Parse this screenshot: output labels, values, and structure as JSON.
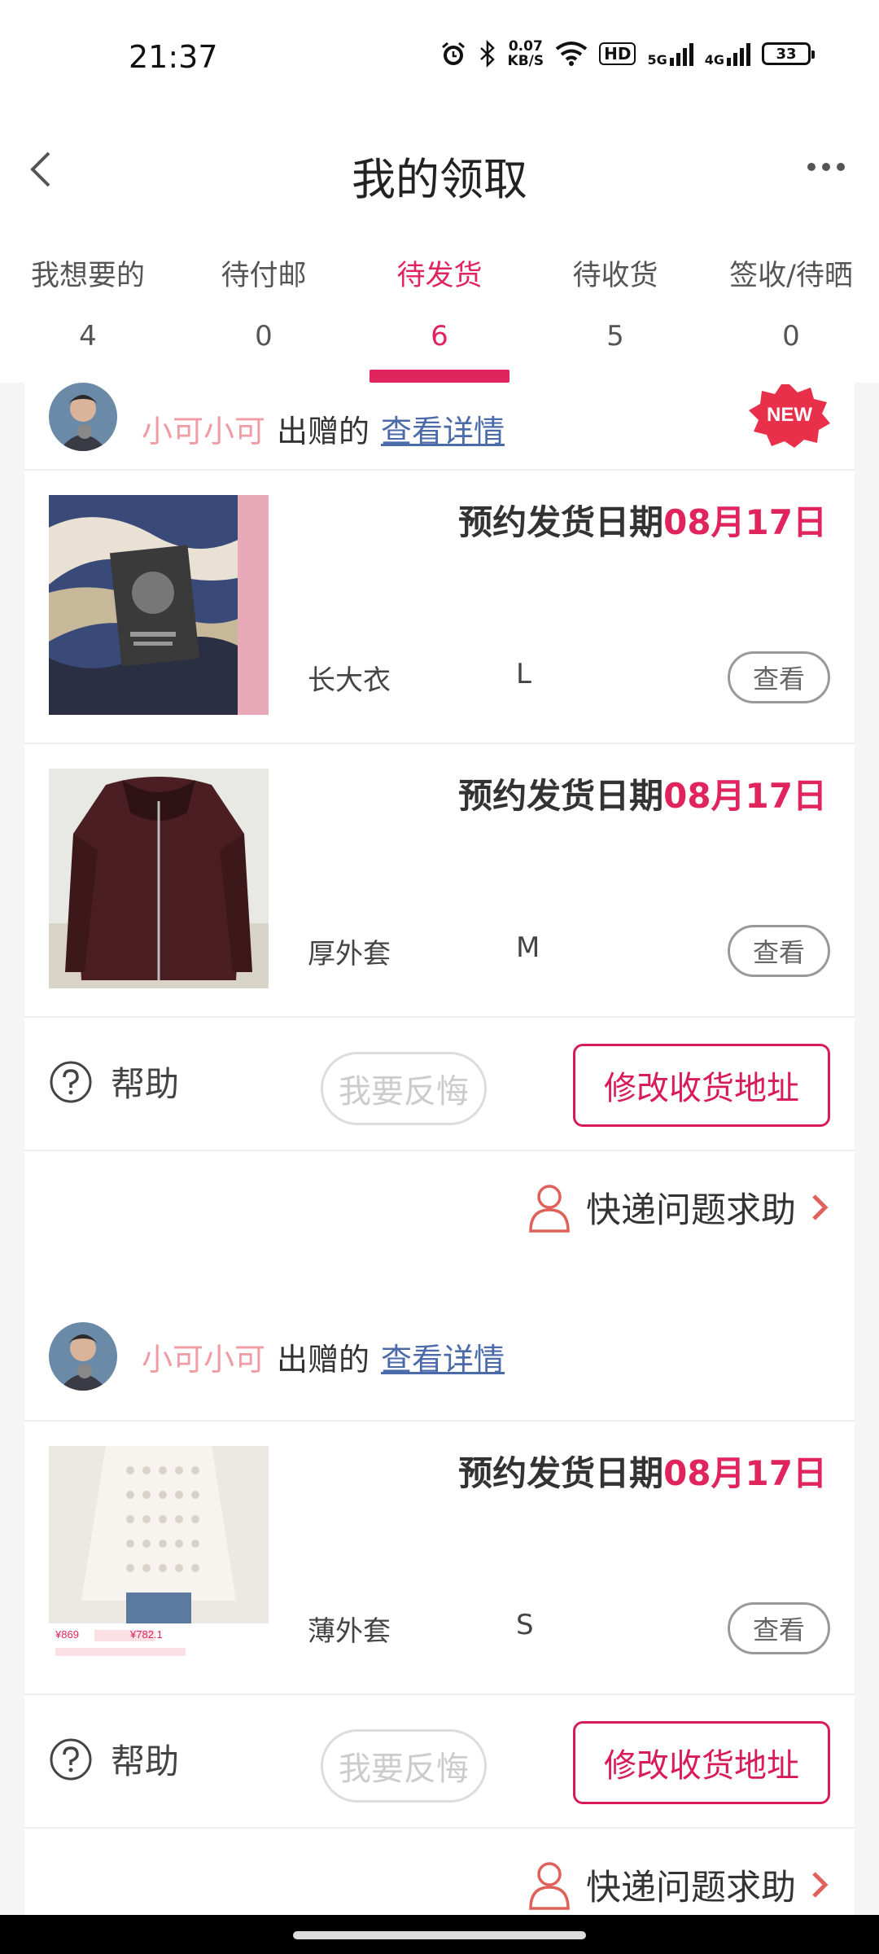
{
  "status_bar": {
    "time": "21:37",
    "net_speed_value": "0.07",
    "net_speed_unit": "KB/S",
    "hd_label": "HD",
    "net1_label": "5G",
    "net2_label": "4G",
    "battery": "33"
  },
  "nav": {
    "title": "我的领取"
  },
  "tabs": [
    {
      "label": "我想要的",
      "count": "4",
      "active": false
    },
    {
      "label": "待付邮",
      "count": "0",
      "active": false
    },
    {
      "label": "待发货",
      "count": "6",
      "active": true
    },
    {
      "label": "待收货",
      "count": "5",
      "active": false
    },
    {
      "label": "签收/待晒",
      "count": "0",
      "active": false
    }
  ],
  "cards": [
    {
      "giver": "小可小可",
      "giver_suffix": "出赠的",
      "detail_link": "查看详情",
      "new_badge": "NEW",
      "items": [
        {
          "ship_label": "预约发货日期",
          "ship_date": "08月17日",
          "name": "长大衣",
          "size": "L",
          "view_label": "查看"
        },
        {
          "ship_label": "预约发货日期",
          "ship_date": "08月17日",
          "name": "厚外套",
          "size": "M",
          "view_label": "查看"
        }
      ],
      "help_label": "帮助",
      "regret_label": "我要反悔",
      "address_label": "修改收货地址",
      "express_label": "快递问题求助"
    },
    {
      "giver": "小可小可",
      "giver_suffix": "出赠的",
      "detail_link": "查看详情",
      "items": [
        {
          "ship_label": "预约发货日期",
          "ship_date": "08月17日",
          "name": "薄外套",
          "size": "S",
          "view_label": "查看",
          "thumb_price": "¥869",
          "thumb_coupon": "¥782.1"
        }
      ],
      "help_label": "帮助",
      "regret_label": "我要反悔",
      "address_label": "修改收货地址",
      "express_label": "快递问题求助"
    }
  ],
  "colors": {
    "accent": "#e0245e",
    "giver": "#f09ca5",
    "link": "#4a6aa8",
    "background": "#f5f5f5"
  }
}
